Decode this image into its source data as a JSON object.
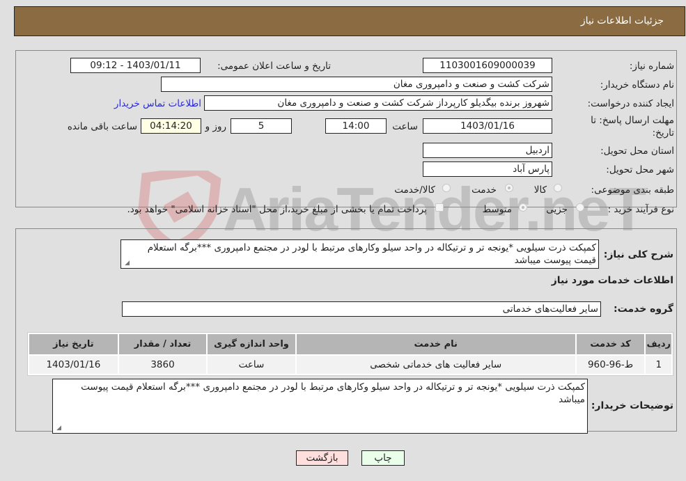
{
  "header": {
    "title": "جزئیات اطلاعات نیاز"
  },
  "form": {
    "need_number": {
      "label": "شماره نیاز:",
      "value": "1103001609000039"
    },
    "announce_datetime": {
      "label": "تاریخ و ساعت اعلان عمومی:",
      "value": "1403/01/11 - 09:12"
    },
    "buyer_org": {
      "label": "نام دستگاه خریدار:",
      "value": "شرکت کشت و صنعت و دامپروری مغان"
    },
    "requester": {
      "label": "ایجاد کننده درخواست:",
      "value": "شهروز برنده بیگدیلو کارپرداز شرکت کشت و صنعت و دامپروری مغان",
      "contact_link": "اطلاعات تماس خریدار"
    },
    "deadline": {
      "label_line1": "مهلت ارسال پاسخ: تا",
      "label_line2": "تاریخ:",
      "date": "1403/01/16",
      "time_label": "ساعت",
      "time": "14:00",
      "days": "5",
      "days_label": "روز و",
      "remaining": "04:14:20",
      "remaining_label": "ساعت باقی مانده"
    },
    "province": {
      "label": "استان محل تحویل:",
      "value": "اردبیل"
    },
    "city": {
      "label": "شهر محل تحویل:",
      "value": "پارس آباد"
    },
    "category": {
      "label": "طبقه بندی موضوعی:",
      "options": [
        {
          "label": "کالا",
          "checked": false
        },
        {
          "label": "خدمت",
          "checked": true
        },
        {
          "label": "کالا/خدمت",
          "checked": false
        }
      ]
    },
    "purchase_type": {
      "label": "نوع فرآیند خرید :",
      "options": [
        {
          "label": "جزیی",
          "checked": false
        },
        {
          "label": "متوسط",
          "checked": true
        }
      ],
      "treasury_checkbox": {
        "label": "پرداخت تمام یا بخشی از مبلغ خرید،از محل \"اسناد خزانه اسلامی\" خواهد بود.",
        "checked": false
      }
    }
  },
  "details": {
    "description_label": "شرح کلی نیاز:",
    "description": "کمپکت ذرت سیلویی *یونجه تر و ترتیکاله در واحد سیلو وکارهای مرتبط با لودر در مجتمع دامپروری ***برگه استعلام قیمت پیوست میباشد",
    "services_title": "اطلاعات خدمات مورد نیاز",
    "service_group_label": "گروه خدمت:",
    "service_group": "سایر فعالیت‌های خدماتی",
    "table": {
      "headers": [
        "ردیف",
        "کد خدمت",
        "نام خدمت",
        "واحد اندازه گیری",
        "تعداد / مقدار",
        "تاریخ نیاز"
      ],
      "rows": [
        [
          "1",
          "ط-96-960",
          "سایر فعالیت های خدماتی شخصی",
          "ساعت",
          "3860",
          "1403/01/16"
        ]
      ]
    },
    "buyer_notes_label": "توضیحات خریدار:",
    "buyer_notes": "کمپکت ذرت سیلویی *یونجه تر و ترتیکاله در واحد سیلو وکارهای مرتبط با لودر در مجتمع دامپروری ***برگه استعلام قیمت پیوست میباشد"
  },
  "buttons": {
    "print": "چاپ",
    "back": "بازگشت"
  },
  "colors": {
    "header_bg": "#8b6c42",
    "print_bg": "#eaffea",
    "back_bg": "#ffdede",
    "link": "#2a2ad4"
  },
  "watermark": {
    "text": "AriaTender.neT"
  }
}
